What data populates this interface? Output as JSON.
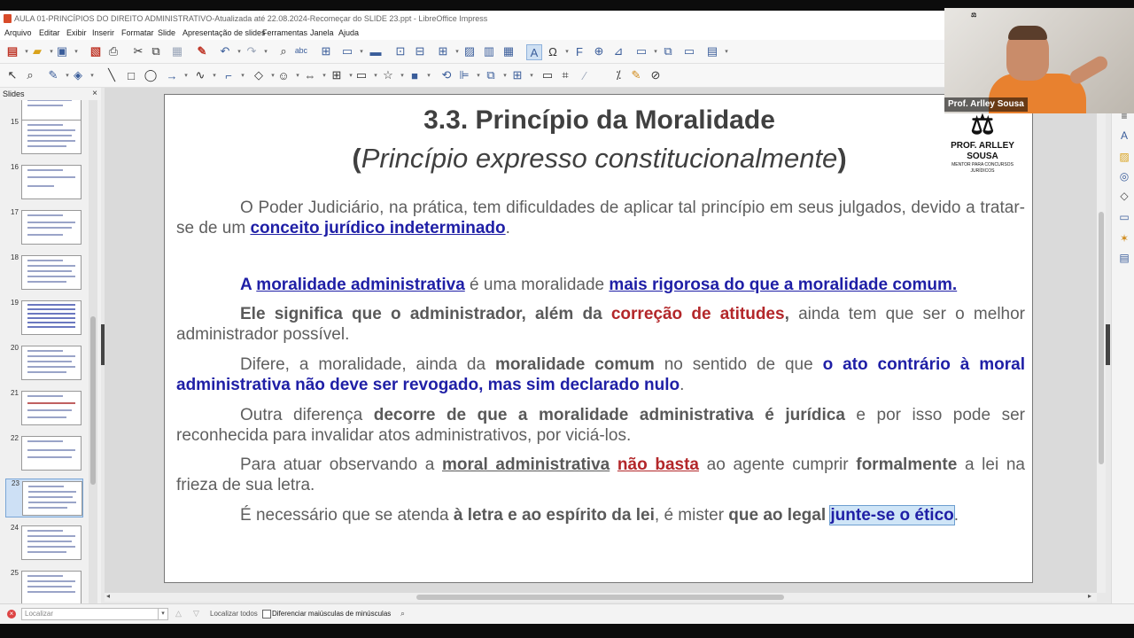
{
  "window": {
    "title": "AULA 01-PRINCÍPIOS DO DIREITO ADMINISTRATIVO-Atualizada até 22.08.2024-Recomeçar do SLIDE 23.ppt - LibreOffice Impress"
  },
  "menu": [
    "Arquivo",
    "Editar",
    "Exibir",
    "Inserir",
    "Formatar",
    "Slide",
    "Apresentação de slides",
    "Ferramentas",
    "Janela",
    "Ajuda"
  ],
  "slides_panel": {
    "title": "Slides",
    "close": "×",
    "numbers": [
      "15",
      "16",
      "17",
      "18",
      "19",
      "20",
      "21",
      "22",
      "23",
      "24",
      "25"
    ],
    "current": "23"
  },
  "webcam": {
    "caption": "Prof. Arlley Sousa"
  },
  "slide": {
    "title": "3.3. Princípio da Moralidade",
    "subtitle_open": "(",
    "subtitle": "Princípio expresso constitucionalmente",
    "subtitle_close": ")",
    "logo_name": "PROF. ARLLEY SOUSA",
    "logo_tag": "MENTOR PARA CONCURSOS JURÍDICOS",
    "p1": {
      "a": "O Poder Judiciário, na prática, tem dificuldades de aplicar tal princípio em seus julgados, devido a tratar-se de um ",
      "b": "conceito jurídico indeterminado",
      "c": "."
    },
    "p2": {
      "a": "A ",
      "b": "moralidade administrativa",
      "c": " é uma moralidade ",
      "d": "mais rigorosa do que a moralidade comum."
    },
    "p3": {
      "a": "Ele significa que o administrador, além da ",
      "b": "correção de atitudes",
      "c": ",",
      "d": " ainda tem que ser o melhor administrador possível."
    },
    "p4": {
      "a": "Difere, a moralidade, ainda da ",
      "b": "moralidade comum",
      "c": " no sentido de que ",
      "d": "o ato contrário à moral administrativa não deve ser revogado, mas sim declarado nulo",
      "e": "."
    },
    "p5": {
      "a": "Outra diferença ",
      "b": "decorre de que a moralidade administrativa é jurídica",
      "c": " e por isso pode ser reconhecida para invalidar atos administrativos, por viciá-los."
    },
    "p6": {
      "a": "Para atuar observando a ",
      "b": "moral administrativa",
      "c": " ",
      "d": "não basta",
      "e": " ao agente cumprir ",
      "f": "formalmente",
      "g": " a lei na frieza de sua letra."
    },
    "p7": {
      "a": "É necessário que se atenda ",
      "b": "à letra e ao espírito da lei",
      "c": ", é mister ",
      "d": "que ao legal",
      "e": " ",
      "f": "junte-se o ético",
      "g": "."
    }
  },
  "findbar": {
    "placeholder": "Localizar",
    "find_all": "Localizar todos",
    "match_case": "Diferenciar maiúsculas de minúsculas"
  }
}
